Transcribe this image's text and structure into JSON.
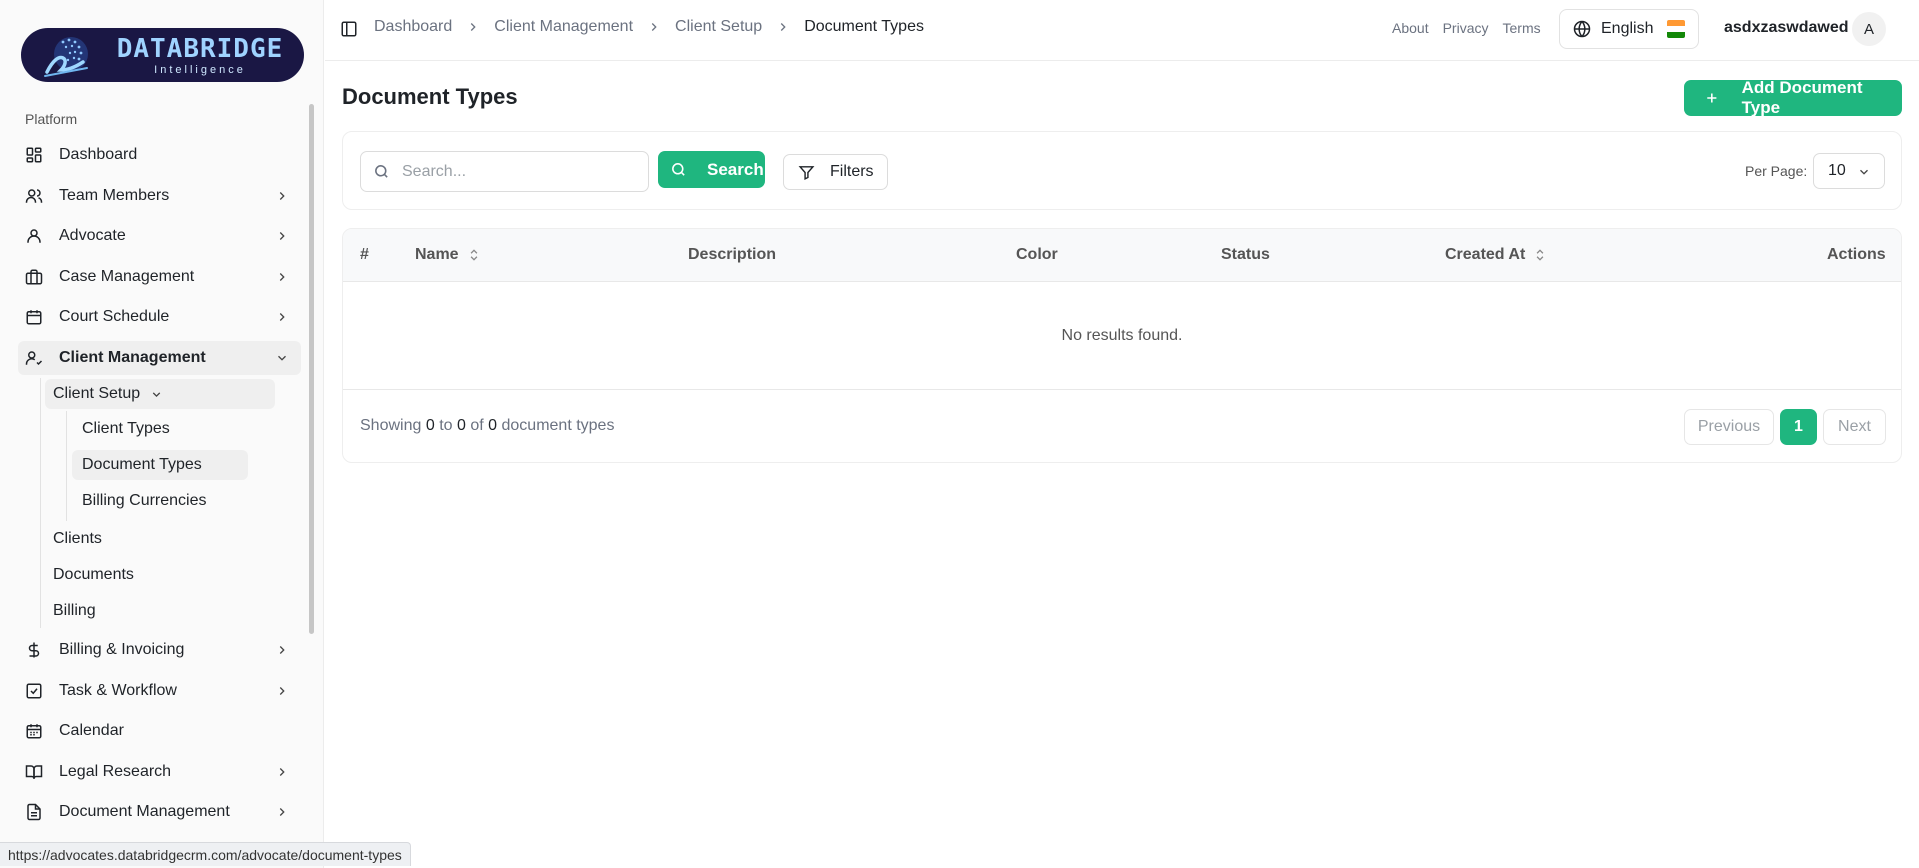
{
  "logo": {
    "title": "DATABRIDGE",
    "subtitle": "Intelligence"
  },
  "sidebar": {
    "group_label": "Platform",
    "items": [
      {
        "label": "Dashboard",
        "icon": "dashboard-grid-icon",
        "expandable": false
      },
      {
        "label": "Team Members",
        "icon": "users-icon",
        "expandable": true
      },
      {
        "label": "Advocate",
        "icon": "user-icon",
        "expandable": true
      },
      {
        "label": "Case Management",
        "icon": "briefcase-icon",
        "expandable": true
      },
      {
        "label": "Court Schedule",
        "icon": "calendar-icon",
        "expandable": true
      },
      {
        "label": "Client Management",
        "icon": "user-check-icon",
        "expandable": true,
        "expanded": true
      },
      {
        "label": "Billing & Invoicing",
        "icon": "dollar-icon",
        "expandable": true
      },
      {
        "label": "Task & Workflow",
        "icon": "checkbox-icon",
        "expandable": true
      },
      {
        "label": "Calendar",
        "icon": "calendar-days-icon",
        "expandable": false
      },
      {
        "label": "Legal Research",
        "icon": "book-open-icon",
        "expandable": true
      },
      {
        "label": "Document Management",
        "icon": "file-text-icon",
        "expandable": true
      }
    ],
    "client_management_children": {
      "client_setup": {
        "label": "Client Setup",
        "children": [
          "Client Types",
          "Document Types",
          "Billing Currencies"
        ]
      },
      "others": [
        "Clients",
        "Documents",
        "Billing"
      ]
    }
  },
  "status_bar": {
    "url": "https://advocates.databridgecrm.com/advocate/document-types"
  },
  "header": {
    "breadcrumbs": [
      "Dashboard",
      "Client Management",
      "Client Setup",
      "Document Types"
    ],
    "links": [
      "About",
      "Privacy",
      "Terms"
    ],
    "language": "English",
    "user_name": "asdxzaswdawed",
    "avatar_initial": "A"
  },
  "page": {
    "title": "Document Types",
    "add_button": "Add Document Type"
  },
  "filters": {
    "search_placeholder": "Search...",
    "search_value": "",
    "search_button": "Search",
    "filters_button": "Filters",
    "per_page_label": "Per Page:",
    "per_page_value": "10"
  },
  "table": {
    "columns": [
      "#",
      "Name",
      "Description",
      "Color",
      "Status",
      "Created At",
      "Actions"
    ],
    "empty_message": "No results found.",
    "showing_prefix": "Showing",
    "showing_from": "0",
    "showing_to_word": "to",
    "showing_to": "0",
    "showing_of_word": "of",
    "showing_total": "0",
    "showing_suffix": "document types"
  },
  "pagination": {
    "previous": "Previous",
    "current": "1",
    "next": "Next"
  },
  "colors": {
    "accent": "#1fb67f",
    "logo_bg": "#1a1744"
  }
}
